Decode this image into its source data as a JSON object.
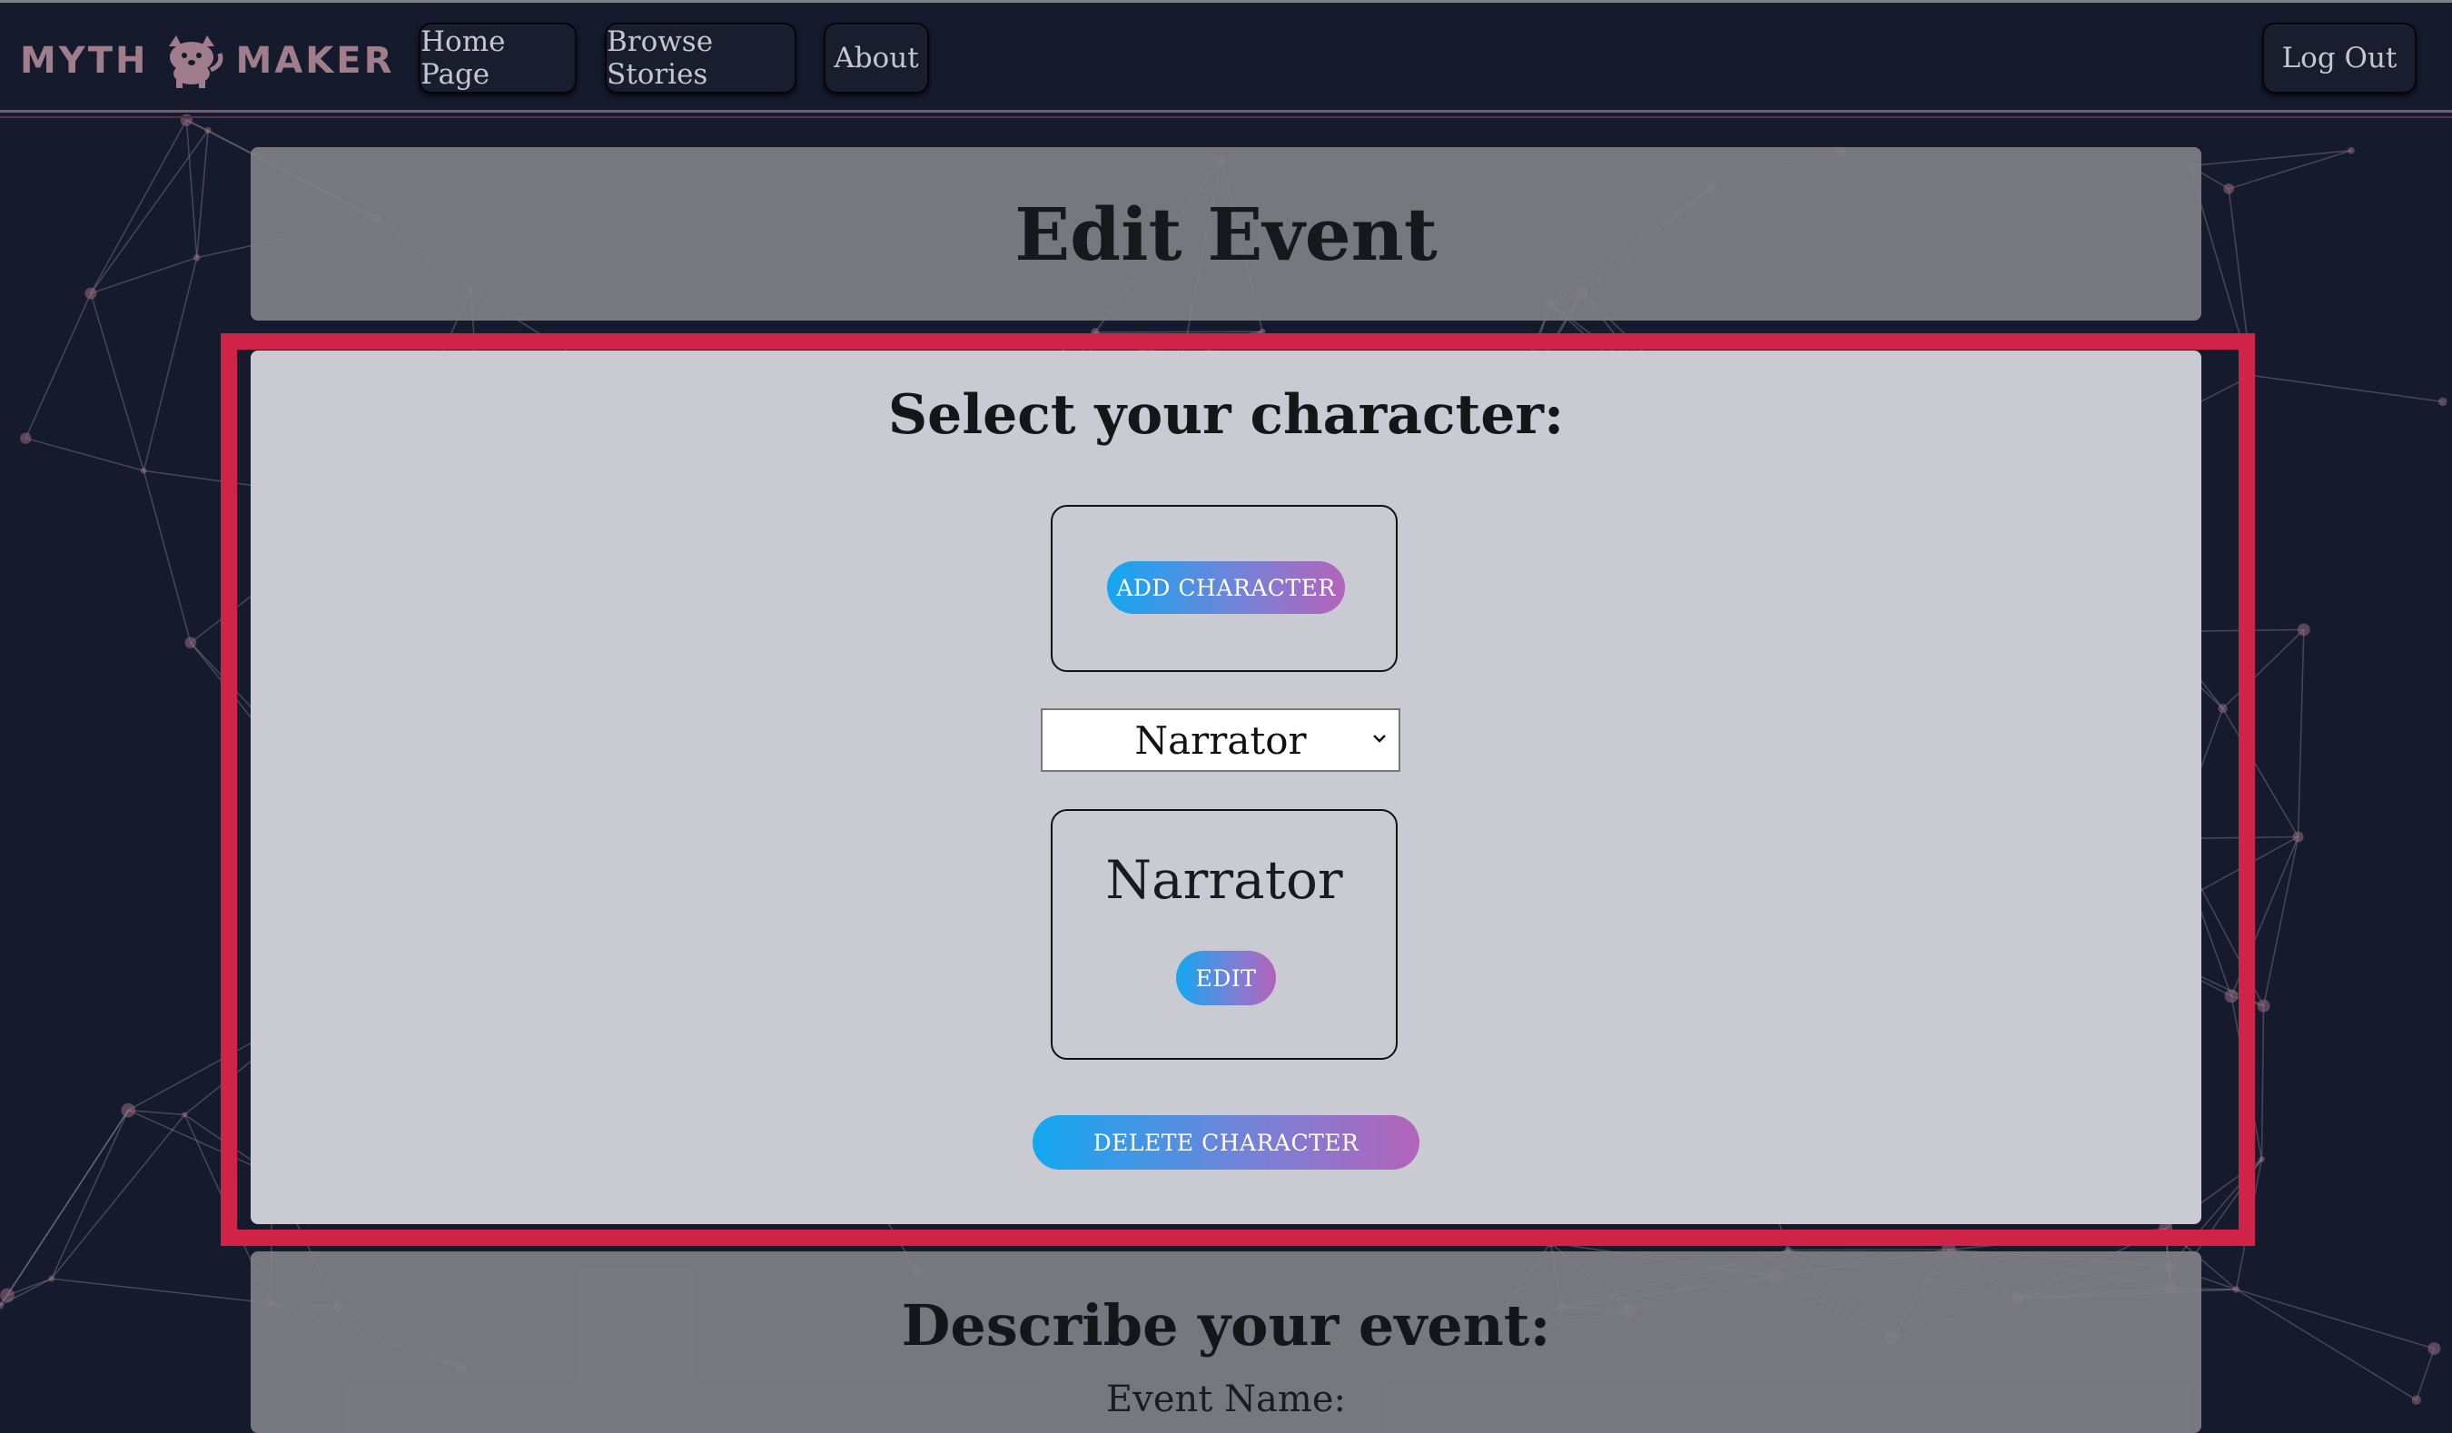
{
  "navbar": {
    "logo_left": "MYTH",
    "logo_right": "MAKER",
    "mascot_icon": "dog-mascot-icon",
    "home_label": "Home Page",
    "browse_label": "Browse Stories",
    "about_label": "About",
    "logout_label": "Log Out"
  },
  "header": {
    "title": "Edit Event"
  },
  "character_section": {
    "heading": "Select your character:",
    "add_button": "ADD CHARACTER",
    "select_value": "Narrator",
    "card_name": "Narrator",
    "edit_button": "EDIT",
    "delete_button": "DELETE CHARACTER"
  },
  "event_section": {
    "heading": "Describe your event:",
    "name_label": "Event Name:"
  },
  "colors": {
    "background": "#161a2d",
    "highlight_border": "#cf2347",
    "gradient_start": "#12a8f0",
    "gradient_end": "#b463b9",
    "logo": "#a07d8b"
  }
}
